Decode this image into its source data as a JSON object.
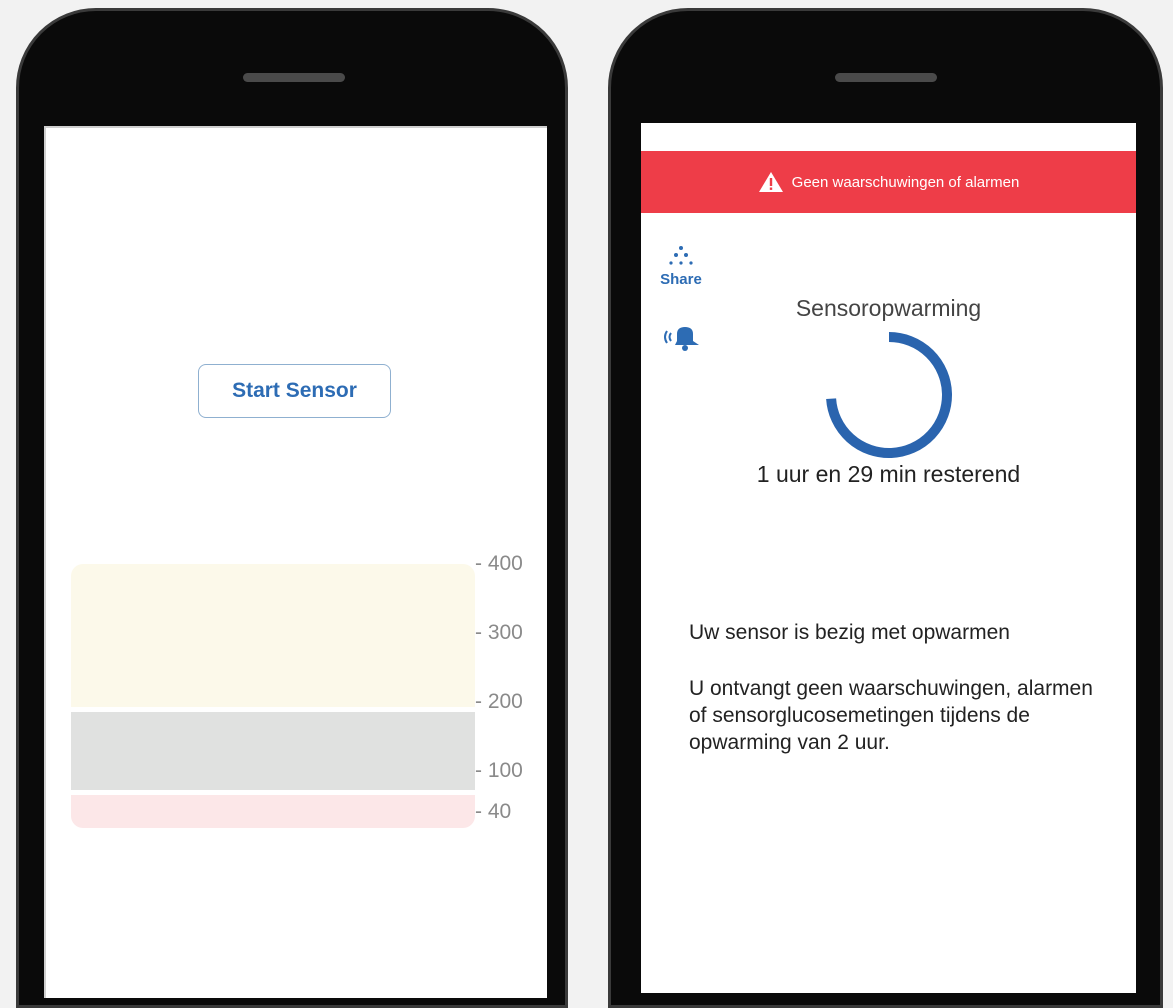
{
  "left_screen": {
    "start_button_label": "Start Sensor",
    "chart_data": {
      "type": "area",
      "categories": [],
      "y_ticks": [
        "400",
        "300",
        "200",
        "100",
        "40"
      ],
      "ylim": [
        40,
        400
      ],
      "bands": [
        {
          "name": "high",
          "from": 200,
          "to": 400,
          "color": "#fcf9ea"
        },
        {
          "name": "target",
          "from": 70,
          "to": 180,
          "color": "#e0e1e0"
        },
        {
          "name": "low",
          "from": 40,
          "to": 70,
          "color": "#fce7e8"
        }
      ],
      "title": "",
      "xlabel": "",
      "ylabel": ""
    }
  },
  "right_screen": {
    "alert_text": "Geen waarschuwingen of alarmen",
    "share_label": "Share",
    "warmup_title": "Sensoropwarming",
    "warmup_progress": 0.26,
    "remaining_text": "1 uur en 29 min resterend",
    "info_line1": "Uw sensor is bezig met opwarmen",
    "info_line2": "U ontvangt geen waarschuwingen, alarmen of sensorglucosemetingen tijdens de opwarming van 2 uur.",
    "colors": {
      "alert": "#ee3d48",
      "accent": "#2d6cb4"
    },
    "icons": [
      "warning-icon",
      "share-icon",
      "alarm-bell-icon"
    ]
  }
}
